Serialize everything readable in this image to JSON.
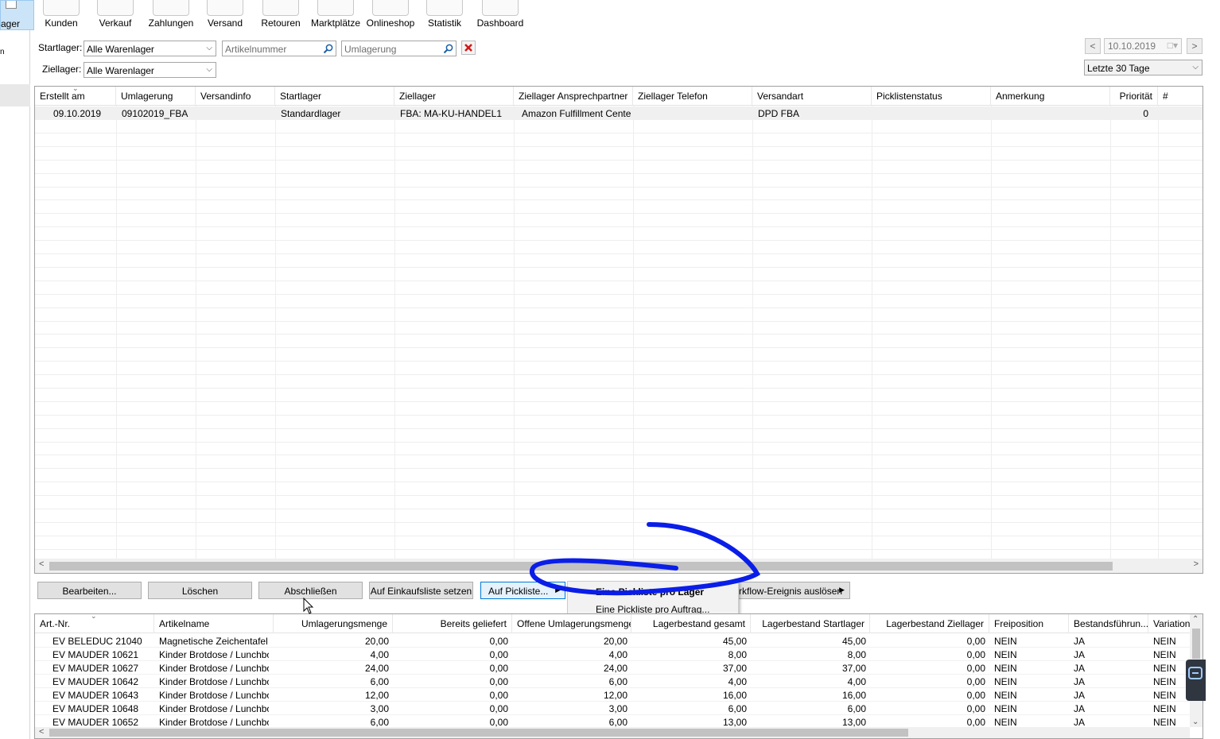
{
  "left_tab": {
    "label": "ager"
  },
  "toolbar": {
    "items": [
      {
        "label": "Kunden",
        "icon": "customers-icon"
      },
      {
        "label": "Verkauf",
        "icon": "sales-icon"
      },
      {
        "label": "Zahlungen",
        "icon": "payments-icon"
      },
      {
        "label": "Versand",
        "icon": "shipping-icon"
      },
      {
        "label": "Retouren",
        "icon": "returns-icon"
      },
      {
        "label": "Marktplätze",
        "icon": "marketplaces-icon"
      },
      {
        "label": "Onlineshop",
        "icon": "onlineshop-icon"
      },
      {
        "label": "Statistik",
        "icon": "statistics-icon"
      },
      {
        "label": "Dashboard",
        "icon": "dashboard-icon"
      }
    ]
  },
  "filters": {
    "startlager_label": "Startlager:",
    "startlager_value": "Alle Warenlager",
    "ziellager_label": "Ziellager:",
    "ziellager_value": "Alle Warenlager",
    "article_placeholder": "Artikelnummer",
    "umlagerung_placeholder": "Umlagerung",
    "date_value": "10.10.2019",
    "range_value": "Letzte 30 Tage"
  },
  "top_grid": {
    "columns": [
      "Erstellt am",
      "Umlagerung",
      "Versandinfo",
      "Startlager",
      "Ziellager",
      "Ziellager Ansprechpartner",
      "Ziellager Telefon",
      "Versandart",
      "Picklistenstatus",
      "Anmerkung",
      "Priorität",
      "#"
    ],
    "rows": [
      [
        "09.10.2019",
        "09102019_FBA",
        "",
        "Standardlager",
        "FBA: MA-KU-HANDEL1",
        "Amazon Fulfillment Center",
        "",
        "DPD FBA",
        "",
        "",
        "0",
        ""
      ]
    ]
  },
  "buttons": {
    "bearbeiten": "Bearbeiten...",
    "loeschen": "Löschen",
    "abschliessen": "Abschließen",
    "einkaufsliste": "Auf Einkaufsliste setzen",
    "pickliste": "Auf Pickliste...",
    "workflow": "rkflow-Ereignis auslösen"
  },
  "context_menu": {
    "items": [
      "Eine Pickliste pro Lager",
      "Eine Pickliste pro Auftrag..."
    ]
  },
  "bottom_grid": {
    "columns": [
      "Art.-Nr.",
      "Artikelname",
      "Umlagerungsmenge",
      "Bereits geliefert",
      "Offene Umlagerungsmenge",
      "Lagerbestand gesamt",
      "Lagerbestand Startlager",
      "Lagerbestand Ziellager",
      "Freiposition",
      "Bestandsführun...",
      "Variations"
    ],
    "rows": [
      [
        "EV BELEDUC 21040",
        "Magnetische Zeichentafel ...",
        "20,00",
        "0,00",
        "20,00",
        "45,00",
        "45,00",
        "0,00",
        "NEIN",
        "JA",
        "NEIN"
      ],
      [
        "EV MAUDER 10621",
        "Kinder Brotdose / Lunchbo...",
        "4,00",
        "0,00",
        "4,00",
        "8,00",
        "8,00",
        "0,00",
        "NEIN",
        "JA",
        "NEIN"
      ],
      [
        "EV MAUDER 10627",
        "Kinder Brotdose / Lunchbo...",
        "24,00",
        "0,00",
        "24,00",
        "37,00",
        "37,00",
        "0,00",
        "NEIN",
        "JA",
        "NEIN"
      ],
      [
        "EV MAUDER 10642",
        "Kinder Brotdose / Lunchbo...",
        "6,00",
        "0,00",
        "6,00",
        "4,00",
        "4,00",
        "0,00",
        "NEIN",
        "JA",
        "NEIN"
      ],
      [
        "EV MAUDER 10643",
        "Kinder Brotdose / Lunchbo...",
        "12,00",
        "0,00",
        "12,00",
        "16,00",
        "16,00",
        "0,00",
        "NEIN",
        "JA",
        "NEIN"
      ],
      [
        "EV MAUDER 10648",
        "Kinder Brotdose / Lunchbo...",
        "3,00",
        "0,00",
        "3,00",
        "6,00",
        "6,00",
        "0,00",
        "NEIN",
        "JA",
        "NEIN"
      ],
      [
        "EV MAUDER 10652",
        "Kinder Brotdose / Lunchbo...",
        "6,00",
        "0,00",
        "6,00",
        "13,00",
        "13,00",
        "0,00",
        "NEIN",
        "JA",
        "NEIN"
      ]
    ]
  },
  "colors": {
    "annotation": "#0a1ee8",
    "selection": "#cce4f7",
    "row_highlight": "#f0f0f0"
  }
}
